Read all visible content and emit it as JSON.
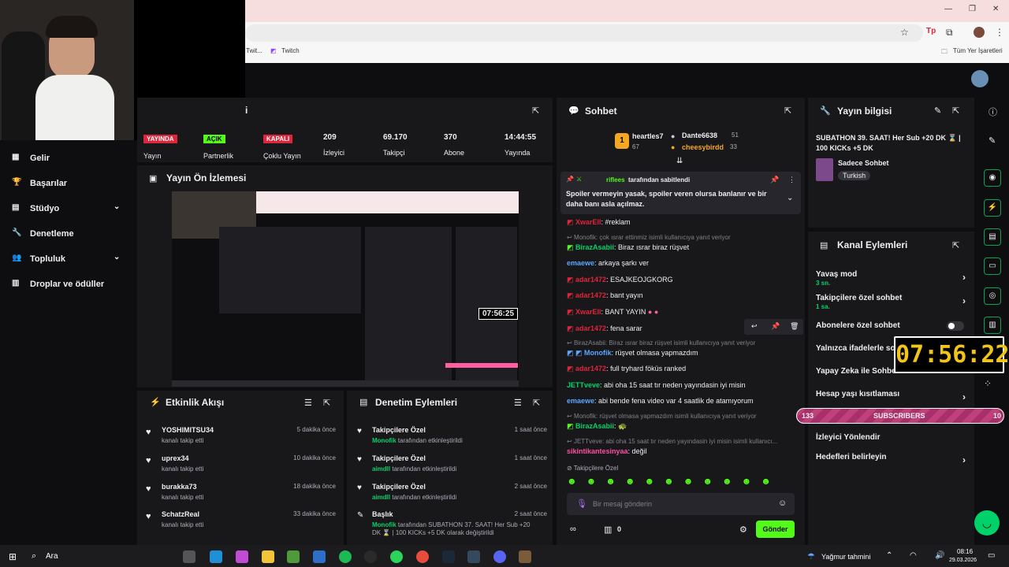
{
  "browser": {
    "bookmark_twitch": "Twitch",
    "bookmark_partial": "Twit...",
    "bookmarks_all": "Tüm Yer İşaretleri"
  },
  "sidebar": {
    "items": [
      {
        "label": "Gelir",
        "icon": "revenue-icon"
      },
      {
        "label": "Başarılar",
        "icon": "trophy-icon"
      },
      {
        "label": "Stüdyo",
        "icon": "studio-icon",
        "expandable": true
      },
      {
        "label": "Denetleme",
        "icon": "wrench-icon"
      },
      {
        "label": "Topluluk",
        "icon": "community-icon",
        "expandable": true
      },
      {
        "label": "Droplar ve ödüller",
        "icon": "drops-icon"
      }
    ]
  },
  "stream_stats": {
    "header_fragment": "i",
    "status_label": "YAYINDA",
    "status_caption": "Yayın",
    "partner_label": "AÇIK",
    "partner_caption": "Partnerlik",
    "multi_label": "KAPALI",
    "multi_caption": "Çoklu Yayın",
    "viewers": "209",
    "viewers_caption": "İzleyici",
    "followers": "69.170",
    "followers_caption": "Takipçi",
    "subs": "370",
    "subs_caption": "Abone",
    "uptime": "14:44:55",
    "uptime_caption": "Yayında"
  },
  "preview": {
    "title": "Yayın Ön İzlemesi",
    "timer": "07:56:25"
  },
  "activity": {
    "title": "Etkinlik Akışı",
    "items": [
      {
        "name": "YOSHIMITSU34",
        "sub": "kanalı takip etti",
        "time": "5 dakika önce"
      },
      {
        "name": "uprex34",
        "sub": "kanalı takip etti",
        "time": "10 dakika önce"
      },
      {
        "name": "burakka73",
        "sub": "kanalı takip etti",
        "time": "18 dakika önce"
      },
      {
        "name": "SchatzReal",
        "sub": "kanalı takip etti",
        "time": "33 dakika önce"
      }
    ]
  },
  "moderation": {
    "title": "Denetim Eylemleri",
    "items": [
      {
        "name": "Takipçilere Özel",
        "actor": "Monofik",
        "rest": "tarafından etkinleştirildi",
        "time": "1 saat önce"
      },
      {
        "name": "Takipçilere Özel",
        "actor": "aimdll",
        "rest": "tarafından etkinleştirildi",
        "time": "1 saat önce"
      },
      {
        "name": "Takipçilere Özel",
        "actor": "aimdll",
        "rest": "tarafından etkinleştirildi",
        "time": "2 saat önce"
      },
      {
        "name": "Başlık",
        "actor": "Monofik",
        "rest": "tarafından SUBATHON 37. SAAT! Her Sub +20",
        "rest2": "DK ⌛ | 100 KICKs +5 DK olarak değiştirildi",
        "time": "2 saat önce"
      }
    ]
  },
  "chat": {
    "title": "Sohbet",
    "leaderboard": {
      "rank": "1",
      "first_name": "heartles7",
      "first_value": "67",
      "second_name": "Dante6638",
      "second_value": "51",
      "third_name": "cheesybirdd",
      "third_value": "33"
    },
    "pinned": {
      "by": "riflees",
      "by_suffix": "tarafından sabitlendi",
      "text": "Spoiler vermeyin yasak, spoiler veren olursa banlanır ve bir daha banı asla açılmaz."
    },
    "messages": [
      {
        "type": "msg",
        "user": "XwarEll",
        "color": "red",
        "text": ": #reklam"
      },
      {
        "type": "reply",
        "text": "Monofik: çok ısrar ettinmiz isimli kullanıcıya yanıt veriyor"
      },
      {
        "type": "msg",
        "user": "BirazAsabii",
        "color": "green",
        "text": ": Biraz ısrar biraz rüşvet"
      },
      {
        "type": "msg",
        "user": "emaewe",
        "color": "blue",
        "text": ": arkaya şarkı ver"
      },
      {
        "type": "msg",
        "user": "adar1472",
        "color": "red",
        "text": ": ESAJKEOJGKORG"
      },
      {
        "type": "msg",
        "user": "adar1472",
        "color": "red",
        "text": ": bant yayın"
      },
      {
        "type": "msg",
        "user": "XwarEll",
        "color": "red",
        "text": ": BANT YAYIN"
      },
      {
        "type": "msg",
        "user": "adar1472",
        "color": "red",
        "text": ": fena sarar"
      },
      {
        "type": "reply",
        "text": "BirazAsabii: Biraz ısrar biraz rüşvet isimli kullanıcıya yanıt veriyor"
      },
      {
        "type": "msg",
        "user": "Monofik",
        "color": "blue",
        "text": ": rüşvet olmasa yapmazdım"
      },
      {
        "type": "msg",
        "user": "adar1472",
        "color": "red",
        "text": ": full tryhard föküs ranked"
      },
      {
        "type": "msg",
        "user": "JETTveve",
        "color": "green",
        "text": ": abi oha 15 saat tır neden yayındasin iyi misin"
      },
      {
        "type": "msg",
        "user": "emaewe",
        "color": "blue",
        "text": ": abi bende fena video var 4 saatlik de atamıyorum"
      },
      {
        "type": "reply",
        "text": "Monofik: rüşvet olmasa yapmazdım isimli kullanıcıya yanıt veriyor"
      },
      {
        "type": "msg",
        "user": "BirazAsabii",
        "color": "green",
        "text": ":"
      },
      {
        "type": "reply",
        "text": "JETTveve: abi oha 15 saat tır neden yayındasin iyi misin isimli kullanıcı..."
      },
      {
        "type": "msg",
        "user": "sikintikantesinyaa",
        "color": "pink",
        "text": ": değil"
      }
    ],
    "followers_only_label": "Takipçilere Özel",
    "input_placeholder": "Bir mesaj gönderin",
    "points_value": "0",
    "send_label": "Gönder"
  },
  "stream_info": {
    "title": "Yayın bilgisi",
    "stream_title": "SUBATHON 39. SAAT! Her Sub +20 DK ⌛ | 100 KICKs +5 DK",
    "category": "Sadece Sohbet",
    "tag": "Turkish"
  },
  "channel_actions": {
    "title": "Kanal Eylemleri",
    "items": [
      {
        "label": "Yavaş mod",
        "sub": "3 sn."
      },
      {
        "label": "Takipçilere özel sohbet",
        "sub": "1 sa."
      },
      {
        "label": "Abonelere özel sohbet",
        "sub": ""
      },
      {
        "label": "Yalnızca ifadelerle sohbet",
        "sub": ""
      },
      {
        "label": "Yapay Zeka ile Sohbet",
        "sub": ""
      },
      {
        "label": "Hesap yaşı kısıtlaması",
        "sub": ""
      },
      {
        "label": "İzleyici Yönlendir",
        "sub": ""
      },
      {
        "label": "Hedefleri belirleyin",
        "sub": ""
      }
    ],
    "sub_goal_current": "133",
    "sub_goal_label": "SUBSCRIBERS",
    "sub_goal_target": "10",
    "overlay_timer": "07:56:22"
  },
  "taskbar": {
    "search": "Ara",
    "weather": "Yağmur tahmini",
    "time": "08:16",
    "date": "29.03.2026"
  },
  "colors": {
    "accent": "#53fc18",
    "live_red": "#e0243b",
    "panel": "#18181b",
    "bg": "#0e0e10"
  }
}
